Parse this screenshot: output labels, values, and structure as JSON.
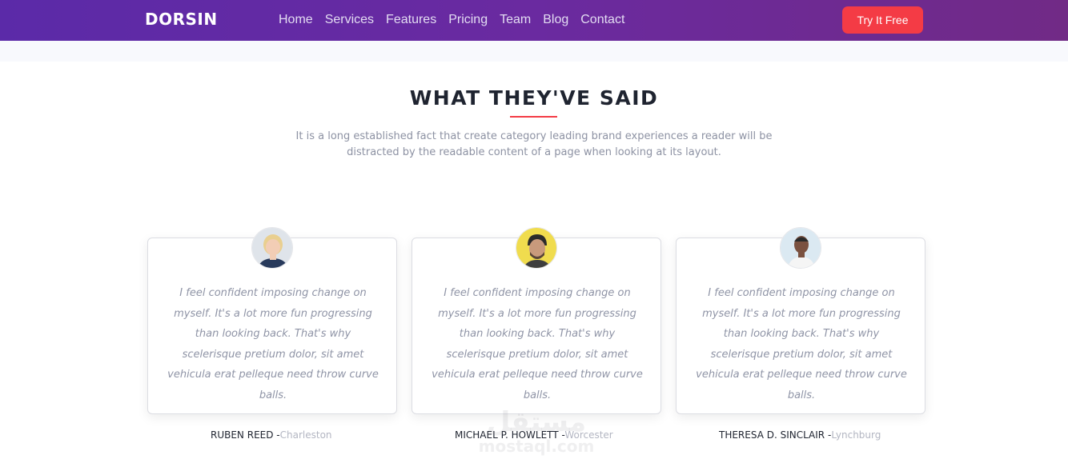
{
  "header": {
    "logo": "DORSIN",
    "nav": [
      "Home",
      "Services",
      "Features",
      "Pricing",
      "Team",
      "Blog",
      "Contact"
    ],
    "cta": "Try It Free"
  },
  "section": {
    "title": "WHAT THEY'VE SAID",
    "description": "It is a long established fact that create category leading brand experiences a reader will be distracted by the readable content of a page when looking at its layout."
  },
  "testimonials": [
    {
      "quote": "I feel confident imposing change on myself. It's a lot more fun progressing than looking back. That's why scelerisque pretium dolor, sit amet vehicula erat pelleque need throw curve balls.",
      "name": "RUBEN REED",
      "separator": " -",
      "city": "Charleston"
    },
    {
      "quote": "I feel confident imposing change on myself. It's a lot more fun progressing than looking back. That's why scelerisque pretium dolor, sit amet vehicula erat pelleque need throw curve balls.",
      "name": "MICHAEL P. HOWLETT",
      "separator": " -",
      "city": "Worcester"
    },
    {
      "quote": "I feel confident imposing change on myself. It's a lot more fun progressing than looking back. That's why scelerisque pretium dolor, sit amet vehicula erat pelleque need throw curve balls.",
      "name": "THERESA D. SINCLAIR",
      "separator": " -",
      "city": "Lynchburg"
    }
  ],
  "watermark": {
    "arabic": "مستقل",
    "latin": "mostaql.com"
  },
  "colors": {
    "accent": "#f43b45",
    "nav_gradient_start": "#5b2aa8",
    "nav_gradient_end": "#712a86",
    "heading": "#1f2430",
    "muted": "#8d92a3"
  }
}
